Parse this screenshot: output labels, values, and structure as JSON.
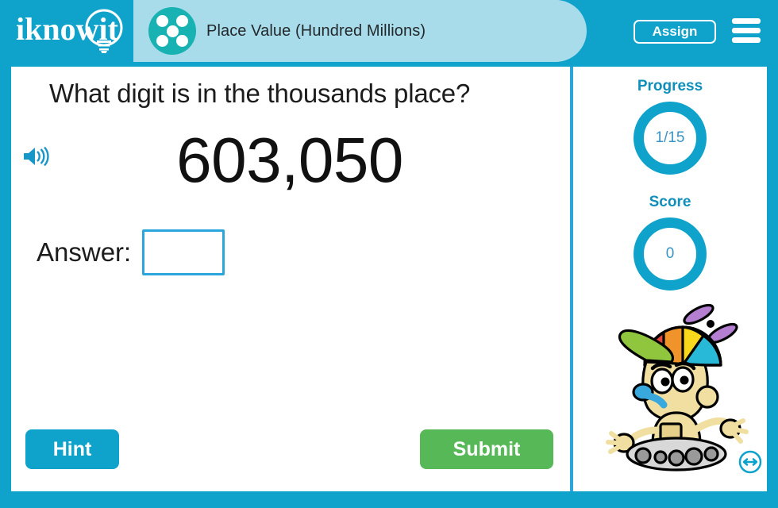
{
  "header": {
    "logo_text": "iknowit",
    "logo_icon": "lightbulb-icon",
    "activity_icon": "dice-five-icon",
    "activity_title": "Place Value (Hundred Millions)",
    "assign_label": "Assign",
    "menu_icon": "hamburger-menu-icon"
  },
  "question": {
    "audio_icon": "speaker-icon",
    "prompt": "What digit is in the thousands place?",
    "number": "603,050",
    "answer_label": "Answer:",
    "answer_value": "",
    "answer_placeholder": ""
  },
  "actions": {
    "hint_label": "Hint",
    "submit_label": "Submit"
  },
  "sidebar": {
    "progress_label": "Progress",
    "progress_value": "1/15",
    "score_label": "Score",
    "score_value": "0",
    "mascot_icon": "robot-mascot-icon",
    "resize_icon": "resize-horizontal-icon"
  },
  "colors": {
    "brand_blue": "#0fa3cb",
    "pill_blue": "#a8dcea",
    "badge_teal": "#19b2b2",
    "accent_blue": "#2ba6dc",
    "submit_green": "#56b856",
    "label_blue": "#0f8fba"
  }
}
